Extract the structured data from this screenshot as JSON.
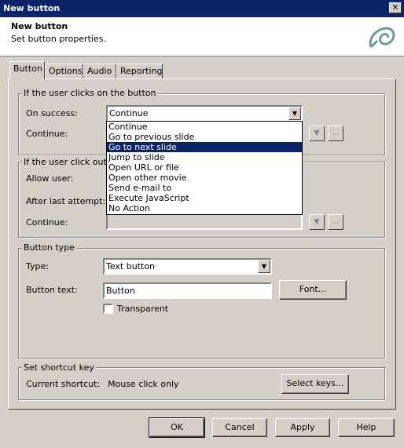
{
  "window": {
    "title": "New button",
    "close_glyph": "✕"
  },
  "header": {
    "title": "New button",
    "subtitle": "Set button properties."
  },
  "tabs": [
    {
      "label": "Button",
      "active": true
    },
    {
      "label": "Options"
    },
    {
      "label": "Audio"
    },
    {
      "label": "Reporting"
    }
  ],
  "success_group": {
    "legend": "If the user clicks on the button",
    "on_success_label": "On success:",
    "on_success_value": "Continue",
    "continue_label": "Continue:"
  },
  "dropdown": {
    "options": [
      "Continue",
      "Go to previous slide",
      "Go to next slide",
      "Jump to slide",
      "Open URL or file",
      "Open other movie",
      "Send e-mail to",
      "Execute JavaScript",
      "No Action"
    ],
    "selected_index": 2
  },
  "fail_group": {
    "legend": "If the user click outsid",
    "allow_label": "Allow user:",
    "after_label": "After last attempt:",
    "continue_label": "Continue:"
  },
  "buttontype_group": {
    "legend": "Button type",
    "type_label": "Type:",
    "type_value": "Text button",
    "text_label": "Button text:",
    "text_value": "Button",
    "font_button": "Font...",
    "transparent_label": "Transparent"
  },
  "shortcut_group": {
    "legend": "Set shortcut key",
    "current_label": "Current shortcut:",
    "current_value": "Mouse click only",
    "select_keys_button": "Select keys..."
  },
  "footer": {
    "ok": "OK",
    "cancel": "Cancel",
    "apply": "Apply",
    "help": "Help"
  },
  "small_button_ellipsis": "...",
  "small_button_arrow": "▼",
  "combo_arrow": "▼"
}
